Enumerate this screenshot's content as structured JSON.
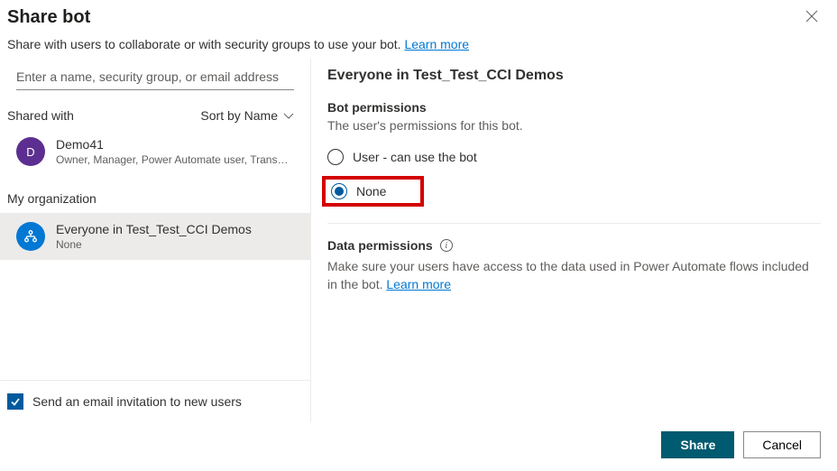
{
  "header": {
    "title": "Share bot"
  },
  "description": {
    "text": "Share with users to collaborate or with security groups to use your bot. ",
    "link": "Learn more"
  },
  "search": {
    "placeholder": "Enter a name, security group, or email address"
  },
  "shared": {
    "label": "Shared with",
    "sort": "Sort by Name"
  },
  "users": [
    {
      "initial": "D",
      "name": "Demo41",
      "roles": "Owner, Manager, Power Automate user, Transc...",
      "avatar_color": "purple"
    }
  ],
  "org": {
    "label": "My organization",
    "item": {
      "name": "Everyone in Test_Test_CCI Demos",
      "sub": "None"
    }
  },
  "email_invite": {
    "label": "Send an email invitation to new users",
    "checked": true
  },
  "right": {
    "title": "Everyone in Test_Test_CCI Demos",
    "bot_perm": {
      "title": "Bot permissions",
      "desc": "The user's permissions for this bot.",
      "options": {
        "user": "User - can use the bot",
        "none": "None"
      },
      "selected": "none"
    },
    "data_perm": {
      "title": "Data permissions",
      "desc": "Make sure your users have access to the data used in Power Automate flows included in the bot. ",
      "link": "Learn more"
    }
  },
  "footer": {
    "share": "Share",
    "cancel": "Cancel"
  }
}
